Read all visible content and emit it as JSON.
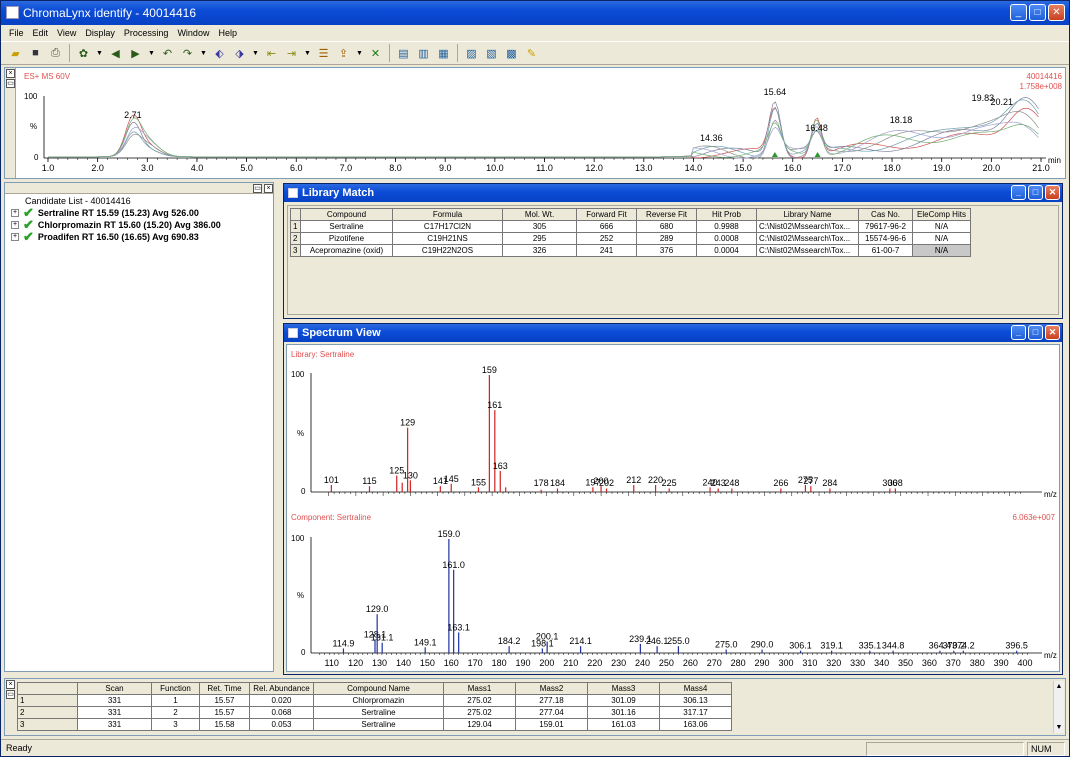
{
  "window": {
    "title": "ChromaLynx identify - 40014416"
  },
  "menu": [
    "File",
    "Edit",
    "View",
    "Display",
    "Processing",
    "Window",
    "Help"
  ],
  "chromatogram": {
    "header_left": "ES+ MS 60V",
    "header_right1": "40014416",
    "header_right2": "1.758e+008",
    "x_unit": "min",
    "y_top": "100",
    "y_mid": "%",
    "y_zero": "0",
    "x_ticks": [
      "1.0",
      "2.0",
      "3.0",
      "4.0",
      "5.0",
      "6.0",
      "7.0",
      "8.0",
      "9.0",
      "10.0",
      "11.0",
      "12.0",
      "13.0",
      "14.0",
      "15.0",
      "16.0",
      "17.0",
      "18.0",
      "19.0",
      "20.0",
      "21.0"
    ],
    "peak_labels": [
      {
        "x": 2.71,
        "label": "2.71"
      },
      {
        "x": 14.36,
        "label": "14.36"
      },
      {
        "x": 15.64,
        "label": "15.64"
      },
      {
        "x": 16.48,
        "label": "16.48"
      },
      {
        "x": 18.18,
        "label": "18.18"
      },
      {
        "x": 19.83,
        "label": "19.83"
      },
      {
        "x": 20.21,
        "label": "20.21"
      }
    ]
  },
  "candidate_list": {
    "title": "Candidate List - 40014416",
    "items": [
      {
        "label": "Sertraline RT 15.59 (15.23) Avg 526.00"
      },
      {
        "label": "Chlorpromazin RT 15.60 (15.20) Avg 386.00"
      },
      {
        "label": "Proadifen RT 16.50 (16.65) Avg 690.83"
      }
    ]
  },
  "library_match": {
    "title": "Library Match",
    "columns": [
      "Compound",
      "Formula",
      "Mol. Wt.",
      "Forward Fit",
      "Reverse Fit",
      "Hit Prob",
      "Library Name",
      "Cas No.",
      "EleComp Hits"
    ],
    "rows": [
      {
        "n": "1",
        "cells": [
          "Sertraline",
          "C17H17Cl2N",
          "305",
          "666",
          "680",
          "0.9988",
          "C:\\Nist02\\Mssearch\\Tox...",
          "79617-96-2",
          "N/A"
        ]
      },
      {
        "n": "2",
        "cells": [
          "Pizotifene",
          "C19H21NS",
          "295",
          "252",
          "289",
          "0.0008",
          "C:\\Nist02\\Mssearch\\Tox...",
          "15574-96-6",
          "N/A"
        ]
      },
      {
        "n": "3",
        "cells": [
          "Acepromazine (oxid)",
          "C19H22N2OS",
          "326",
          "241",
          "376",
          "0.0004",
          "C:\\Nist02\\Mssearch\\Tox...",
          "61-00-7",
          "N/A"
        ]
      }
    ]
  },
  "spectrum_view": {
    "title": "Spectrum View",
    "library_label": "Library: Sertraline",
    "component_label": "Component: Sertraline",
    "component_scale": "6.063e+007",
    "x_unit": "m/z",
    "library_peaks": [
      {
        "mz": 101,
        "i": 6,
        "label": "101"
      },
      {
        "mz": 115,
        "i": 5,
        "label": "115"
      },
      {
        "mz": 125,
        "i": 14,
        "label": "125"
      },
      {
        "mz": 127,
        "i": 8
      },
      {
        "mz": 129,
        "i": 55,
        "label": "129"
      },
      {
        "mz": 130,
        "i": 10,
        "label": "130"
      },
      {
        "mz": 141,
        "i": 5,
        "label": "141"
      },
      {
        "mz": 145,
        "i": 7,
        "label": "145"
      },
      {
        "mz": 155,
        "i": 4,
        "label": "155"
      },
      {
        "mz": 159,
        "i": 100,
        "label": "159"
      },
      {
        "mz": 161,
        "i": 70,
        "label": "161"
      },
      {
        "mz": 163,
        "i": 18,
        "label": "163"
      },
      {
        "mz": 165,
        "i": 4
      },
      {
        "mz": 184,
        "i": 3,
        "label": "184"
      },
      {
        "mz": 178,
        "i": 2,
        "label": "178"
      },
      {
        "mz": 197,
        "i": 4,
        "label": "197"
      },
      {
        "mz": 200,
        "i": 5,
        "label": "200"
      },
      {
        "mz": 202,
        "i": 3,
        "label": "202"
      },
      {
        "mz": 212,
        "i": 6,
        "label": "212"
      },
      {
        "mz": 220,
        "i": 6,
        "label": "220"
      },
      {
        "mz": 225,
        "i": 3,
        "label": "225"
      },
      {
        "mz": 240,
        "i": 4,
        "label": "240"
      },
      {
        "mz": 243,
        "i": 3,
        "label": "243"
      },
      {
        "mz": 248,
        "i": 3,
        "label": "248"
      },
      {
        "mz": 266,
        "i": 3,
        "label": "266"
      },
      {
        "mz": 275,
        "i": 6,
        "label": "275"
      },
      {
        "mz": 277,
        "i": 5,
        "label": "277"
      },
      {
        "mz": 284,
        "i": 3,
        "label": "284"
      },
      {
        "mz": 306,
        "i": 3,
        "label": "306"
      },
      {
        "mz": 308,
        "i": 3,
        "label": "308"
      }
    ],
    "component_peaks": [
      {
        "mz": 114.9,
        "i": 4,
        "label": "114.9"
      },
      {
        "mz": 128.1,
        "i": 12,
        "label": "128.1"
      },
      {
        "mz": 129.0,
        "i": 34,
        "label": "129.0"
      },
      {
        "mz": 131.1,
        "i": 9,
        "label": "131.1"
      },
      {
        "mz": 149.1,
        "i": 5,
        "label": "149.1"
      },
      {
        "mz": 159.0,
        "i": 100,
        "label": "159.0"
      },
      {
        "mz": 161.0,
        "i": 73,
        "label": "161.0"
      },
      {
        "mz": 163.1,
        "i": 18,
        "label": "163.1"
      },
      {
        "mz": 184.2,
        "i": 6,
        "label": "184.2"
      },
      {
        "mz": 198.1,
        "i": 4,
        "label": "198.1"
      },
      {
        "mz": 200.1,
        "i": 10,
        "label": "200.1"
      },
      {
        "mz": 214.1,
        "i": 6,
        "label": "214.1"
      },
      {
        "mz": 239.1,
        "i": 8,
        "label": "239.1"
      },
      {
        "mz": 246.1,
        "i": 6,
        "label": "246.1"
      },
      {
        "mz": 255.0,
        "i": 6,
        "label": "255.0"
      },
      {
        "mz": 275.0,
        "i": 3,
        "label": "275.0"
      },
      {
        "mz": 290.0,
        "i": 3,
        "label": "290.0"
      },
      {
        "mz": 306.1,
        "i": 2,
        "label": "306.1"
      },
      {
        "mz": 319.1,
        "i": 2,
        "label": "319.1"
      },
      {
        "mz": 335.1,
        "i": 2,
        "label": "335.1"
      },
      {
        "mz": 344.8,
        "i": 2,
        "label": "344.8"
      },
      {
        "mz": 364.4,
        "i": 2,
        "label": "364.4"
      },
      {
        "mz": 370.2,
        "i": 2,
        "label": "370.2"
      },
      {
        "mz": 374.2,
        "i": 2,
        "label": "374.2"
      },
      {
        "mz": 396.5,
        "i": 2,
        "label": "396.5"
      }
    ],
    "comp_x_ticks": [
      "110",
      "120",
      "130",
      "140",
      "150",
      "160",
      "170",
      "180",
      "190",
      "200",
      "210",
      "220",
      "230",
      "240",
      "250",
      "260",
      "270",
      "280",
      "290",
      "300",
      "310",
      "320",
      "330",
      "340",
      "350",
      "360",
      "370",
      "380",
      "390",
      "400"
    ]
  },
  "scan_table": {
    "columns": [
      "Scan",
      "Function",
      "Ret. Time",
      "Rel. Abundance",
      "Compound Name",
      "Mass1",
      "Mass2",
      "Mass3",
      "Mass4"
    ],
    "rows": [
      {
        "n": "1",
        "cells": [
          "331",
          "1",
          "15.57",
          "0.020",
          "Chlorpromazin",
          "275.02",
          "277.18",
          "301.09",
          "306.13"
        ]
      },
      {
        "n": "2",
        "cells": [
          "331",
          "2",
          "15.57",
          "0.068",
          "Sertraline",
          "275.02",
          "277.04",
          "301.16",
          "317.17"
        ]
      },
      {
        "n": "3",
        "cells": [
          "331",
          "3",
          "15.58",
          "0.053",
          "Sertraline",
          "129.04",
          "159.01",
          "161.03",
          "163.06"
        ]
      }
    ]
  },
  "status": {
    "text": "Ready",
    "num": "NUM"
  }
}
